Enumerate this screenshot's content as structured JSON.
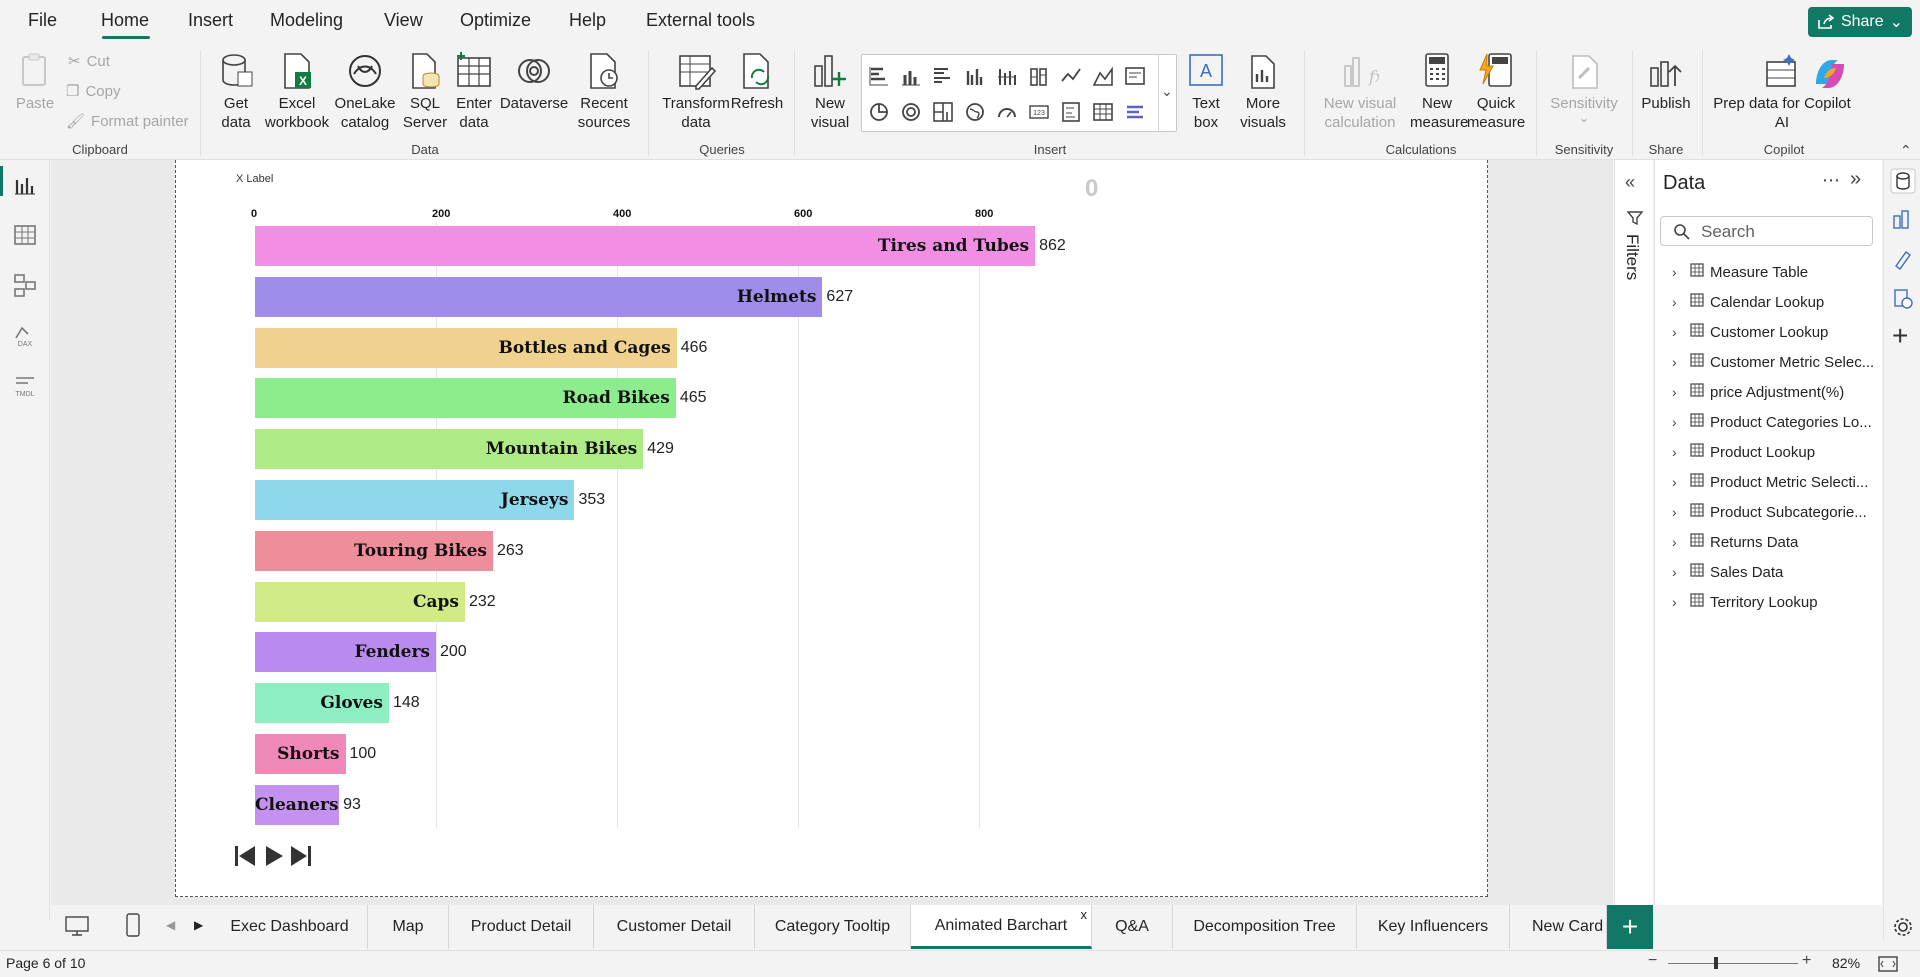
{
  "menu": {
    "items": [
      "File",
      "Home",
      "Insert",
      "Modeling",
      "View",
      "Optimize",
      "Help",
      "External tools"
    ],
    "active": "Home",
    "share_label": "Share"
  },
  "ribbon": {
    "clipboard": {
      "paste": "Paste",
      "cut": "Cut",
      "copy": "Copy",
      "format_painter": "Format painter",
      "label": "Clipboard"
    },
    "data": {
      "get_data": [
        "Get",
        "data"
      ],
      "excel": [
        "Excel",
        "workbook"
      ],
      "onelake": [
        "OneLake",
        "catalog"
      ],
      "sql": [
        "SQL",
        "Server"
      ],
      "enter": [
        "Enter",
        "data"
      ],
      "dataverse": "Dataverse",
      "recent": [
        "Recent",
        "sources"
      ],
      "label": "Data"
    },
    "queries": {
      "transform": [
        "Transform",
        "data"
      ],
      "refresh": "Refresh",
      "label": "Queries"
    },
    "insert": {
      "new_visual": [
        "New",
        "visual"
      ],
      "text_box": [
        "Text",
        "box"
      ],
      "more_visuals": [
        "More",
        "visuals"
      ],
      "label": "Insert"
    },
    "calculations": {
      "new_visual_calc": [
        "New visual",
        "calculation"
      ],
      "new_measure": [
        "New",
        "measure"
      ],
      "quick_measure": [
        "Quick",
        "measure"
      ],
      "label": "Calculations"
    },
    "sensitivity": {
      "btn": "Sensitivity",
      "label": "Sensitivity"
    },
    "share": {
      "publish": "Publish",
      "label": "Share"
    },
    "copilot": {
      "prep": [
        "Prep data for Copilot",
        "AI"
      ],
      "label": "Copilot"
    }
  },
  "chart_data": {
    "type": "bar",
    "xlabel": "X Label",
    "frame_value": "0",
    "ticks": [
      0,
      200,
      400,
      600,
      800
    ],
    "xlim": [
      0,
      1380
    ],
    "categories": [
      "Tires and Tubes",
      "Helmets",
      "Bottles and Cages",
      "Road Bikes",
      "Mountain Bikes",
      "Jerseys",
      "Touring Bikes",
      "Caps",
      "Fenders",
      "Gloves",
      "Shorts",
      "Cleaners"
    ],
    "values": [
      862,
      627,
      466,
      465,
      429,
      353,
      263,
      232,
      200,
      148,
      100,
      93
    ],
    "colors": [
      "#f08fe4",
      "#a08de9",
      "#eed28d",
      "#8ded8e",
      "#aeeb86",
      "#8ed8ec",
      "#ee8e9a",
      "#d1ec86",
      "#ba8bee",
      "#8ceec1",
      "#ef8ab8",
      "#c591ee"
    ]
  },
  "filters_label": "Filters",
  "data_pane": {
    "title": "Data",
    "search_placeholder": "Search",
    "tables": [
      "Measure Table",
      "Calendar Lookup",
      "Customer Lookup",
      "Customer Metric Selec...",
      "price Adjustment(%)",
      "Product Categories Lo...",
      "Product Lookup",
      "Product Metric Selecti...",
      "Product Subcategorie...",
      "Returns Data",
      "Sales Data",
      "Territory Lookup"
    ]
  },
  "tabs": [
    "Exec Dashboard",
    "Map",
    "Product Detail",
    "Customer Detail",
    "Category Tooltip",
    "Animated Barchart",
    "Q&A",
    "Decomposition Tree",
    "Key Influencers",
    "New Card"
  ],
  "active_tab": "Animated Barchart",
  "status": {
    "page": "Page 6 of 10",
    "zoom": "82%"
  }
}
